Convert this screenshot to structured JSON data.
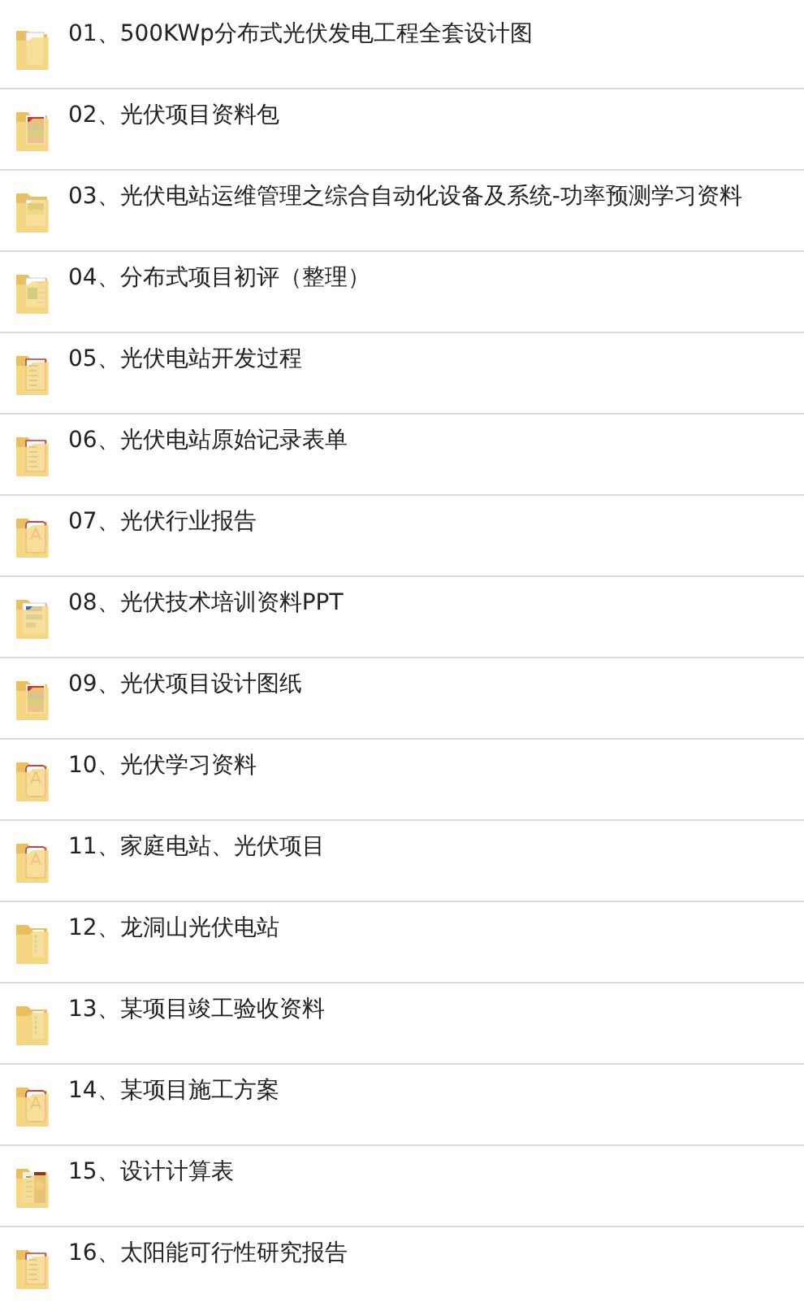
{
  "files": [
    {
      "name": "01、500KWp分布式光伏发电工程全套设计图",
      "kind": "blank"
    },
    {
      "name": "02、光伏项目资料包",
      "kind": "archive"
    },
    {
      "name": "03、光伏电站运维管理之综合自动化设备及系统-功率预测学习资料",
      "kind": "image"
    },
    {
      "name": "04、分布式项目初评（整理）",
      "kind": "spreadsheet"
    },
    {
      "name": "05、光伏电站开发过程",
      "kind": "document"
    },
    {
      "name": "06、光伏电站原始记录表单",
      "kind": "document"
    },
    {
      "name": "07、光伏行业报告",
      "kind": "pdf"
    },
    {
      "name": "08、光伏技术培训资料PPT",
      "kind": "slides"
    },
    {
      "name": "09、光伏项目设计图纸",
      "kind": "archive"
    },
    {
      "name": "10、光伏学习资料",
      "kind": "pdf"
    },
    {
      "name": "11、家庭电站、光伏项目",
      "kind": "pdf"
    },
    {
      "name": "12、龙洞山光伏电站",
      "kind": "sheet"
    },
    {
      "name": "13、某项目竣工验收资料",
      "kind": "sheet"
    },
    {
      "name": "14、某项目施工方案",
      "kind": "pdf"
    },
    {
      "name": "15、设计计算表",
      "kind": "photo"
    },
    {
      "name": "16、太阳能可行性研究报告",
      "kind": "document"
    }
  ]
}
